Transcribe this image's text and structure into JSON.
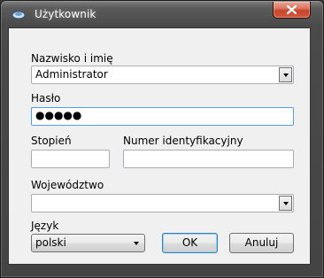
{
  "window": {
    "title": "Użytkownik"
  },
  "form": {
    "name_label": "Nazwisko i imię",
    "name_value": "Administrator",
    "password_label": "Hasło",
    "password_value": "●●●●●",
    "degree_label": "Stopień",
    "degree_value": "",
    "id_number_label": "Numer identyfikacyjny",
    "id_number_value": "",
    "province_label": "Województwo",
    "province_value": "",
    "language_label": "Język",
    "language_value": "polski"
  },
  "buttons": {
    "ok": "OK",
    "cancel": "Anuluj"
  }
}
